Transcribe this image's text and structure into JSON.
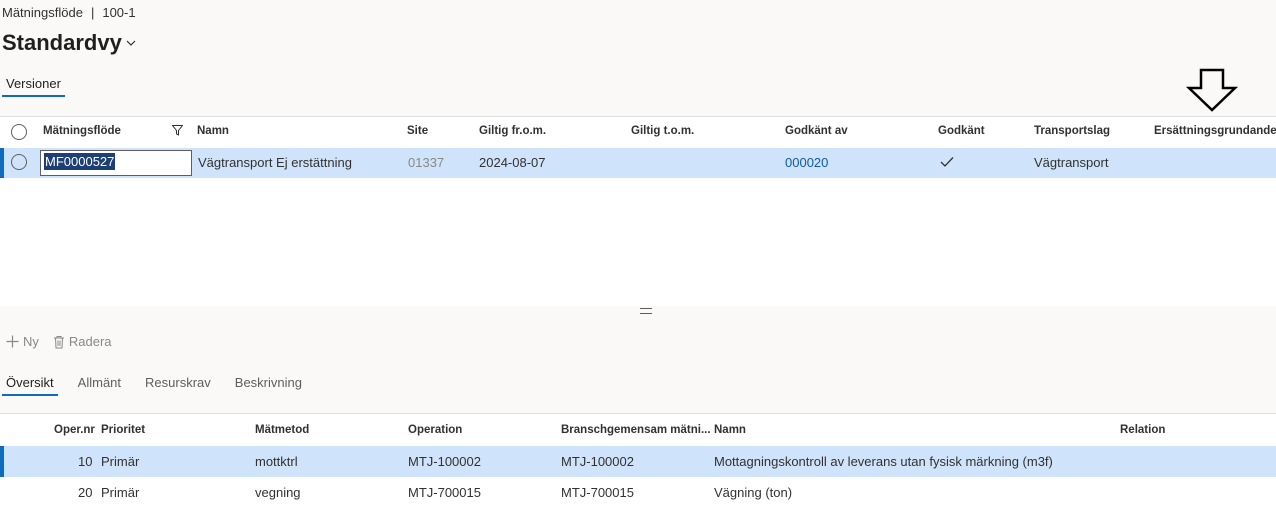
{
  "breadcrumb": {
    "entity": "Mätningsflöde",
    "separator": "|",
    "record": "100-1"
  },
  "view": {
    "title": "Standardvy"
  },
  "top_tabs": [
    {
      "label": "Versioner"
    }
  ],
  "top_grid": {
    "columns": [
      "Mätningsflöde",
      "Namn",
      "Site",
      "Giltig fr.o.m.",
      "Giltig t.o.m.",
      "Godkänt av",
      "Godkänt",
      "Transportslag",
      "Ersättningsgrundande"
    ],
    "rows": [
      {
        "matningsflode": "MF0000527",
        "namn": "Vägtransport Ej erstättning",
        "site": "01337",
        "giltig_from": "2024-08-07",
        "giltig_tom": "",
        "godkant_av": "000020",
        "godkant": true,
        "transportslag": "Vägtransport",
        "ersattningsgrundande": ""
      }
    ]
  },
  "toolbar": {
    "new_label": "Ny",
    "delete_label": "Radera"
  },
  "detail_tabs": [
    {
      "label": "Översikt",
      "active": true
    },
    {
      "label": "Allmänt",
      "active": false
    },
    {
      "label": "Resurskrav",
      "active": false
    },
    {
      "label": "Beskrivning",
      "active": false
    }
  ],
  "bottom_grid": {
    "columns": [
      "Oper.nr",
      "Prioritet",
      "Mätmetod",
      "Operation",
      "Branschgemensam mätni...",
      "Namn",
      "Relation"
    ],
    "rows": [
      {
        "oper_nr": "10",
        "prioritet": "Primär",
        "matmetod": "mottktrl",
        "operation": "MTJ-100002",
        "bransch": "MTJ-100002",
        "namn": "Mottagningskontroll av leverans utan fysisk märkning (m3f)",
        "relation": ""
      },
      {
        "oper_nr": "20",
        "prioritet": "Primär",
        "matmetod": "vegning",
        "operation": "MTJ-700015",
        "bransch": "MTJ-700015",
        "namn": "Vägning (ton)",
        "relation": ""
      }
    ]
  },
  "colors": {
    "accent": "#0f6cbd",
    "selected_row": "#cfe4fa",
    "link": "#0f5ca8"
  }
}
